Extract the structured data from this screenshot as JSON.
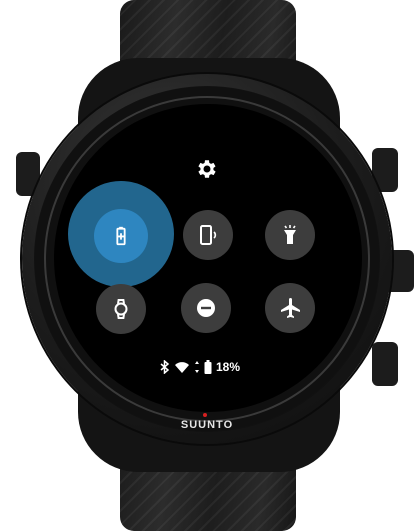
{
  "device": {
    "brand_logo": "SUUNTO"
  },
  "quick_settings": {
    "header_icon": "settings-gear-icon",
    "tiles": [
      {
        "icon": "battery-saver-icon",
        "active": true
      },
      {
        "icon": "phone-ringer-icon",
        "active": false
      },
      {
        "icon": "flashlight-icon",
        "active": false
      },
      {
        "icon": "watch-theater-mode-icon",
        "active": false
      },
      {
        "icon": "do-not-disturb-icon",
        "active": false
      },
      {
        "icon": "airplane-mode-icon",
        "active": false
      }
    ]
  },
  "status_bar": {
    "icons": [
      "bluetooth-icon",
      "wifi-icon",
      "battery-icon"
    ],
    "battery_percent": "18%"
  },
  "colors": {
    "active_tile": "#2e86c0",
    "inactive_tile": "#3d3d3d",
    "screen_bg": "#000000"
  }
}
